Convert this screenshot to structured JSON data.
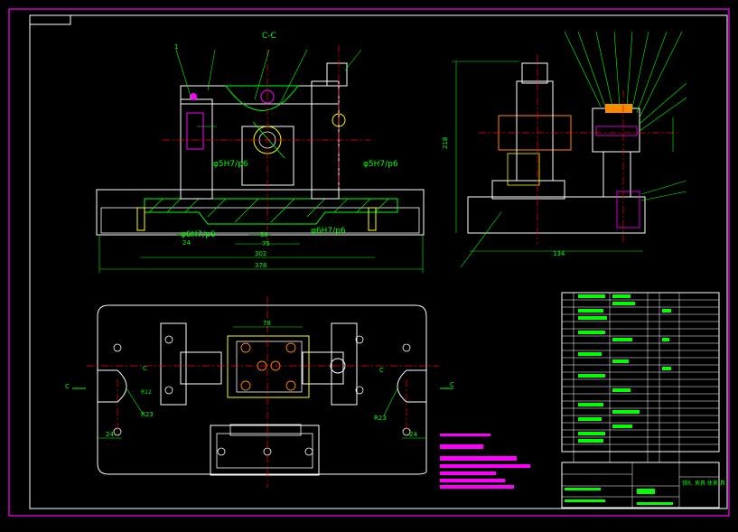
{
  "colors": {
    "background": "#000000",
    "frame": "#ff00ff",
    "outline": "#ffffff",
    "dimension": "#00ff00",
    "centerline": "#ff0000",
    "part": "#ffff00",
    "bushing": "#ff8800",
    "pin": "#ff00ff",
    "highlight": "#00ffff"
  },
  "section_label": "C-C",
  "front_view": {
    "fit_upper_left": "φ5H7/p6",
    "fit_upper_right": "φ5H7/p6",
    "fit_lower_left": "φ6H7/p6",
    "fit_lower_right": "φ6H7/p6",
    "dim_24": "24",
    "dim_38": "38",
    "dim_75": "75",
    "dim_302": "302",
    "dim_378": "378",
    "leader_1": "1"
  },
  "side_view": {
    "dim_height": "218",
    "dim_width": "134"
  },
  "plan_view": {
    "dim_top": "78",
    "radius_left": "R23",
    "radius_right": "R23",
    "dim_left": "24",
    "dim_right": "24",
    "cut_left": "C",
    "cut_right": "C",
    "cut_left_inner": "C",
    "cut_right_inner": "C"
  },
  "title_block": {
    "drawing_title": "铣R, 夹具 体夹 具"
  }
}
